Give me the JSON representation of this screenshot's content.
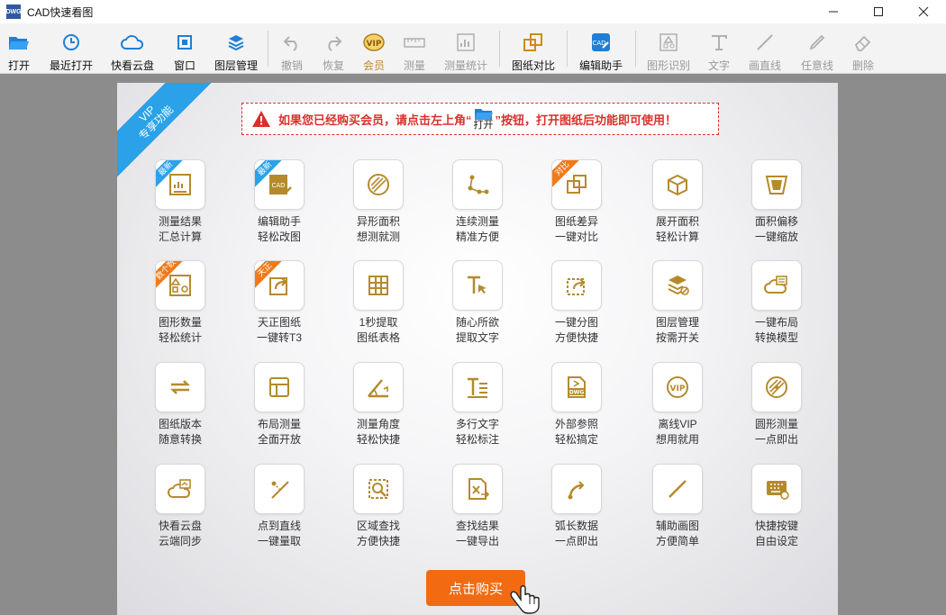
{
  "window": {
    "title": "CAD快速看图",
    "app_icon_text": "DWG"
  },
  "toolbar": {
    "items": [
      {
        "label": "打开",
        "icon": "folder-open-icon"
      },
      {
        "label": "最近打开",
        "icon": "clock-icon"
      },
      {
        "label": "快看云盘",
        "icon": "cloud-icon"
      },
      {
        "label": "窗口",
        "icon": "window-icon"
      },
      {
        "label": "图层管理",
        "icon": "layers-icon"
      },
      {
        "label": "撤销",
        "icon": "undo-icon"
      },
      {
        "label": "恢复",
        "icon": "redo-icon"
      },
      {
        "label": "会员",
        "icon": "vip-icon"
      },
      {
        "label": "测量",
        "icon": "ruler-icon"
      },
      {
        "label": "测量统计",
        "icon": "measure-stats-icon"
      },
      {
        "label": "图纸对比",
        "icon": "compare-icon"
      },
      {
        "label": "编辑助手",
        "icon": "edit-assistant-icon"
      },
      {
        "label": "图形识别",
        "icon": "shape-recognize-icon"
      },
      {
        "label": "文字",
        "icon": "text-icon"
      },
      {
        "label": "画直线",
        "icon": "line-icon"
      },
      {
        "label": "任意线",
        "icon": "freehand-icon"
      },
      {
        "label": "删除",
        "icon": "eraser-icon"
      }
    ]
  },
  "panel": {
    "ribbon_line1": "VIP",
    "ribbon_line2": "专享功能",
    "notice_before": "如果您已经购买会员，请点击左上角“",
    "notice_open_label": "打开",
    "notice_after": "”按钮，打开图纸后功能即可使用！",
    "buy_button": "点击购买"
  },
  "features": [
    {
      "l1": "测量结果",
      "l2": "汇总计算",
      "badge": "最新",
      "icon": "measure-summary-icon"
    },
    {
      "l1": "编辑助手",
      "l2": "轻松改图",
      "badge": "最新",
      "icon": "cad-edit-icon"
    },
    {
      "l1": "异形面积",
      "l2": "想测就测",
      "badge": "",
      "icon": "irregular-area-icon"
    },
    {
      "l1": "连续测量",
      "l2": "精准方便",
      "badge": "",
      "icon": "continuous-measure-icon"
    },
    {
      "l1": "图纸差异",
      "l2": "一键对比",
      "badge": "对比",
      "icon": "drawing-diff-icon"
    },
    {
      "l1": "展开面积",
      "l2": "轻松计算",
      "badge": "",
      "icon": "unfold-area-icon"
    },
    {
      "l1": "面积偏移",
      "l2": "一键缩放",
      "badge": "",
      "icon": "area-offset-icon"
    },
    {
      "l1": "图形数量",
      "l2": "轻松统计",
      "badge": "数个数",
      "icon": "shape-count-icon"
    },
    {
      "l1": "天正图纸",
      "l2": "一键转T3",
      "badge": "天正",
      "icon": "tangent-convert-icon"
    },
    {
      "l1": "1秒提取",
      "l2": "图纸表格",
      "badge": "",
      "icon": "table-extract-icon"
    },
    {
      "l1": "随心所欲",
      "l2": "提取文字",
      "badge": "",
      "icon": "text-extract-icon"
    },
    {
      "l1": "一键分图",
      "l2": "方便快捷",
      "badge": "",
      "icon": "split-drawing-icon"
    },
    {
      "l1": "图层管理",
      "l2": "按需开关",
      "badge": "",
      "icon": "layer-manage-icon"
    },
    {
      "l1": "一键布局",
      "l2": "转换模型",
      "badge": "",
      "icon": "layout-convert-icon"
    },
    {
      "l1": "图纸版本",
      "l2": "随意转换",
      "badge": "",
      "icon": "version-convert-icon"
    },
    {
      "l1": "布局测量",
      "l2": "全面开放",
      "badge": "",
      "icon": "layout-measure-icon"
    },
    {
      "l1": "测量角度",
      "l2": "轻松快捷",
      "badge": "",
      "icon": "angle-measure-icon"
    },
    {
      "l1": "多行文字",
      "l2": "轻松标注",
      "badge": "",
      "icon": "multiline-text-icon"
    },
    {
      "l1": "外部参照",
      "l2": "轻松搞定",
      "badge": "",
      "icon": "xref-dwg-icon"
    },
    {
      "l1": "离线VIP",
      "l2": "想用就用",
      "badge": "",
      "icon": "offline-vip-icon"
    },
    {
      "l1": "圆形测量",
      "l2": "一点即出",
      "badge": "",
      "icon": "circle-measure-icon"
    },
    {
      "l1": "快看云盘",
      "l2": "云端同步",
      "badge": "",
      "icon": "cloud-sync-icon"
    },
    {
      "l1": "点到直线",
      "l2": "一键量取",
      "badge": "",
      "icon": "point-to-line-icon"
    },
    {
      "l1": "区域查找",
      "l2": "方便快捷",
      "badge": "",
      "icon": "area-search-icon"
    },
    {
      "l1": "查找结果",
      "l2": "一键导出",
      "badge": "",
      "icon": "export-results-icon"
    },
    {
      "l1": "弧长数据",
      "l2": "一点即出",
      "badge": "",
      "icon": "arc-length-icon"
    },
    {
      "l1": "辅助画图",
      "l2": "方便简单",
      "badge": "",
      "icon": "draw-assist-icon"
    },
    {
      "l1": "快捷按键",
      "l2": "自由设定",
      "badge": "",
      "icon": "hotkey-icon"
    }
  ]
}
